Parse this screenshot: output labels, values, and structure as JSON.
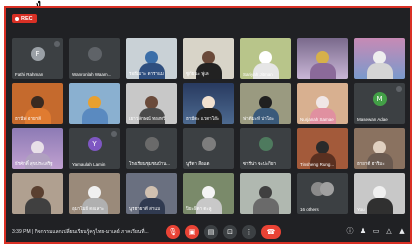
{
  "page": {
    "label": "ง"
  },
  "recording": {
    "label": "REC"
  },
  "meeting": {
    "time": "3:39 PM",
    "title": "กิจกรรมแลกเปลี่ยนเรียนรู้ครูไทย-มาเลย์ ภาคเรียนที่..."
  },
  "participants": [
    {
      "name": "Fathi Rahman",
      "initial": "F",
      "color": "#9aa0a6"
    },
    {
      "name": "Wanronlah Waam...",
      "initial": "",
      "color": "#5f6368"
    },
    {
      "name": "รอฮีเมาะ ดาราแม",
      "initial": "",
      "color": "#8c9aa5"
    },
    {
      "name": "ซูกัยนะ ฟูเล",
      "initial": "",
      "color": "#6d7b66"
    },
    {
      "name": "Sariyah Jitman",
      "initial": "",
      "color": "#7b8b4c"
    },
    {
      "name": "",
      "initial": "",
      "color": "#7a6a8c"
    },
    {
      "name": "",
      "initial": "",
      "color": "#8d7b95"
    },
    {
      "name": "",
      "initial": "",
      "color": "#3c7a80"
    },
    {
      "name": "ฮานีฟ อายาลี",
      "initial": "",
      "color": "#c56a2d"
    },
    {
      "name": "",
      "initial": "",
      "color": "#8ab0d0"
    },
    {
      "name": "เยาวลักษณ์ ทองทวี",
      "initial": "",
      "color": "#a9a9a9"
    },
    {
      "name": "ฮามีดะ แวดาโอ๊ะ",
      "initial": "",
      "color": "#546e7a"
    },
    {
      "name": "ฟาตีมะห์ ปาโอะ",
      "initial": "",
      "color": "#9a9a80"
    },
    {
      "name": "Nurjanah Samae",
      "initial": "",
      "color": "#b39070"
    },
    {
      "name": "Masewan Adae",
      "initial": "M",
      "color": "#43a047"
    },
    {
      "name": "สมศรี ทิฆ 2 นะ",
      "initial": "",
      "color": "#5f6368"
    },
    {
      "name": "ธีรศักดิ์ สุขประเสริฐ",
      "initial": "",
      "color": "#9c7bb5"
    },
    {
      "name": "Yamaulah Lamin",
      "initial": "Y",
      "color": "#7e57c2"
    },
    {
      "name": "โรงเรียนชุมชนบ้าน...",
      "initial": "",
      "color": "#6a6a6a"
    },
    {
      "name": "นูรีดา สือแต",
      "initial": "",
      "color": "#7d7d7d"
    },
    {
      "name": "ซารีน่า จะปะกิยา",
      "initial": "",
      "color": "#4e7a5e"
    },
    {
      "name": "Tinsheng Rung...",
      "initial": "",
      "color": "#a35a3a"
    },
    {
      "name": "ฮายาตี ฮาริมะ",
      "initial": "",
      "color": "#8a7260"
    },
    {
      "name": "",
      "initial": "",
      "color": "#6f6f6f"
    },
    {
      "name": "",
      "initial": "",
      "color": "#b0a090"
    },
    {
      "name": "อุมาไมย์ ดอเลาะ",
      "initial": "",
      "color": "#9a8a7a"
    },
    {
      "name": "นูรฮายาตี สาแม",
      "initial": "",
      "color": "#6a7080"
    },
    {
      "name": "ปิยะธิดา ตะลู",
      "initial": "",
      "color": "#7a8a6a"
    },
    {
      "name": "",
      "initial": "",
      "color": "#5f6368"
    },
    {
      "name": "16 others",
      "initial": "",
      "color": "#5f6368"
    },
    {
      "name": "You",
      "initial": "",
      "color": "#b0b0b0"
    }
  ],
  "toolbar": {
    "mic_icon": "mic-off-icon",
    "cam_icon": "camera-off-icon",
    "cc_icon": "captions-icon",
    "present_icon": "present-icon",
    "more_icon": "more-icon",
    "end_icon": "end-call-icon"
  }
}
